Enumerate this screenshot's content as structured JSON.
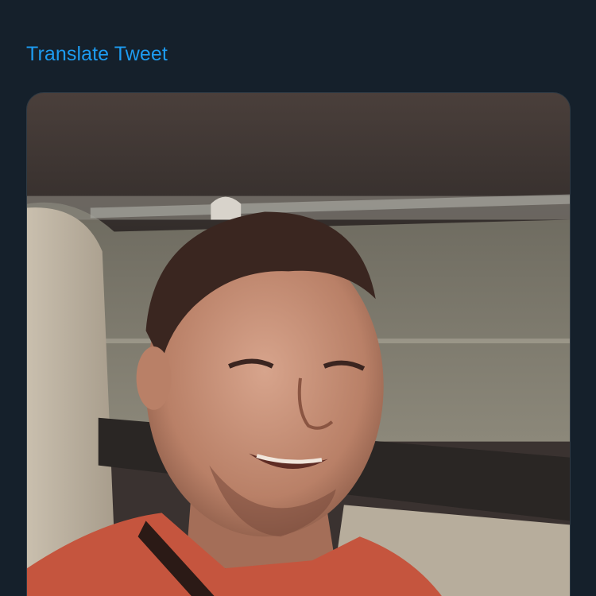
{
  "tweet": {
    "translate_label": "Translate Tweet"
  },
  "media": {
    "type": "video",
    "subject": "video-thumbnail"
  },
  "colors": {
    "background": "#15202b",
    "link": "#1d9bf0"
  }
}
